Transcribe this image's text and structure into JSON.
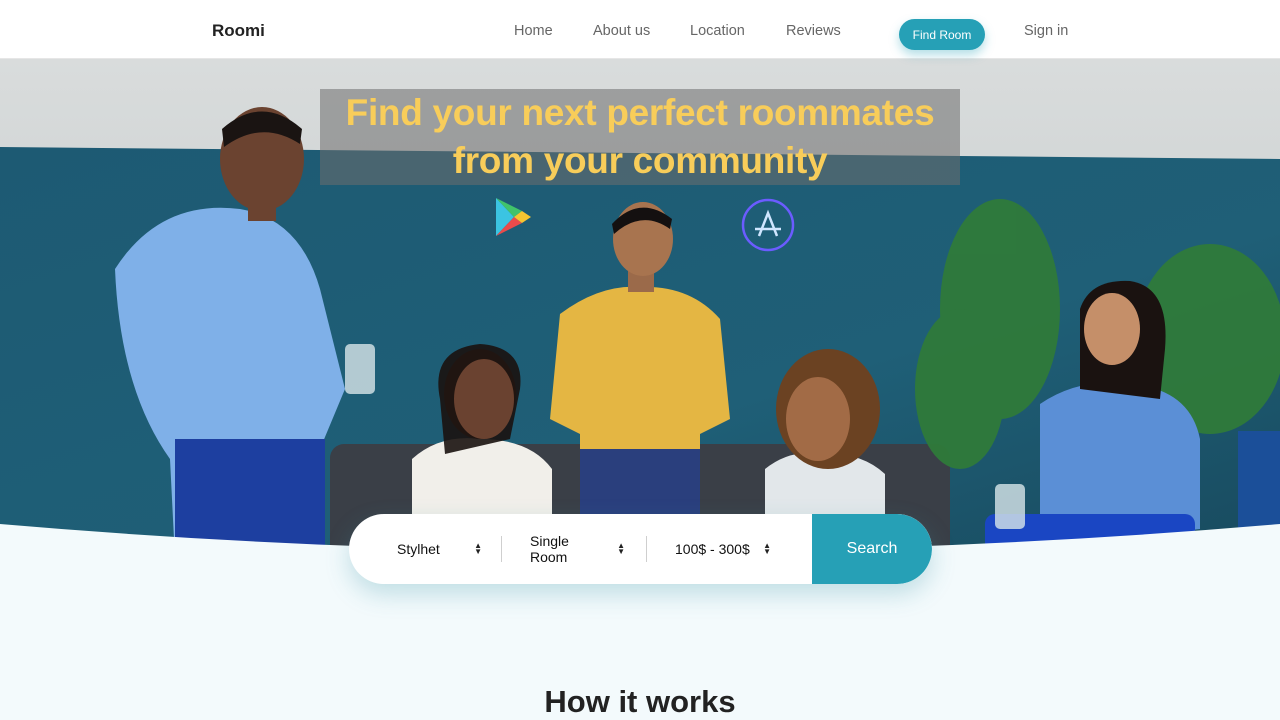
{
  "nav": {
    "brand": "Roomi",
    "links": [
      "Home",
      "About us",
      "Location",
      "Reviews"
    ],
    "find_room_label": "Find Room",
    "signin_label": "Sign in"
  },
  "hero": {
    "headline_line1": "Find your next perfect roommates",
    "headline_line2": "from your community",
    "store_icons": [
      "google-play-icon",
      "app-store-icon"
    ]
  },
  "search": {
    "city": "Stylhet",
    "room_type": "Single Room",
    "price_range": "100$ - 300$",
    "button_label": "Search"
  },
  "section": {
    "title": "How it works"
  },
  "colors": {
    "accent": "#26a0b6",
    "headline": "#f8cd5a",
    "wall": "#1f5a72",
    "page_bg": "#f3fafc"
  }
}
